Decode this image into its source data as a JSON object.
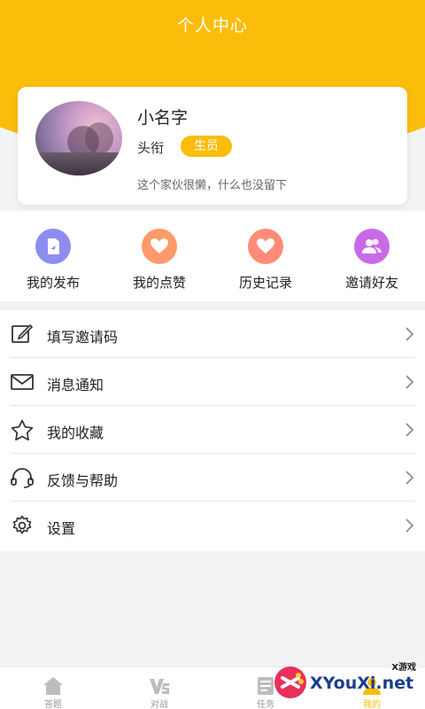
{
  "header": {
    "title": "个人中心"
  },
  "profile": {
    "username": "小名字",
    "title_label": "头衔",
    "title_badge": "生员",
    "signature": "这个家伙很懒，什么也没留下"
  },
  "quick_actions": [
    {
      "label": "我的发布",
      "icon": "publish-icon",
      "color": "#8d8df0"
    },
    {
      "label": "我的点赞",
      "icon": "heart-icon",
      "color": "#ff9a6a"
    },
    {
      "label": "历史记录",
      "icon": "history-heart-icon",
      "color": "#ff8c78"
    },
    {
      "label": "邀请好友",
      "icon": "friends-icon",
      "color": "#c86ae8"
    }
  ],
  "menu": [
    {
      "label": "填写邀请码",
      "icon": "edit-icon"
    },
    {
      "label": "消息通知",
      "icon": "mail-icon"
    },
    {
      "label": "我的收藏",
      "icon": "star-icon"
    },
    {
      "label": "反馈与帮助",
      "icon": "headset-icon"
    },
    {
      "label": "设置",
      "icon": "gear-icon"
    }
  ],
  "bottom_nav": [
    {
      "label": "答题",
      "icon": "home-icon"
    },
    {
      "label": "对战",
      "icon": "vs-icon"
    },
    {
      "label": "任务",
      "icon": "task-icon"
    },
    {
      "label": "我的",
      "icon": "profile-icon",
      "active": true
    }
  ],
  "watermark": {
    "text": "XYouXi.net",
    "sub": "X游戏"
  },
  "colors": {
    "accent": "#fbbd0a",
    "background": "#f2f3f5"
  }
}
